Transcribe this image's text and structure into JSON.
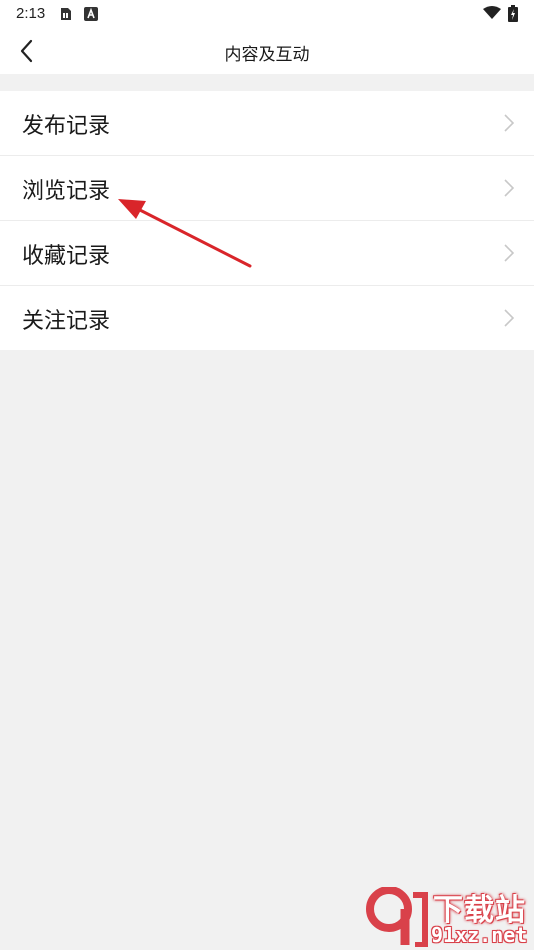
{
  "status_bar": {
    "time": "2:13",
    "icons": [
      "sim-card-icon",
      "a-notification-icon",
      "wifi-icon",
      "battery-charging-icon"
    ]
  },
  "header": {
    "title": "内容及互动",
    "back_icon": "chevron-left-icon"
  },
  "list": {
    "items": [
      {
        "label": "发布记录"
      },
      {
        "label": "浏览记录"
      },
      {
        "label": "收藏记录"
      },
      {
        "label": "关注记录"
      }
    ]
  },
  "annotation": {
    "color": "#d9252a",
    "target": "浏览记录"
  },
  "watermark": {
    "logo_text": "9",
    "top_text": "下载站",
    "bottom_text": "91xz.net",
    "color": "#d9414a"
  }
}
